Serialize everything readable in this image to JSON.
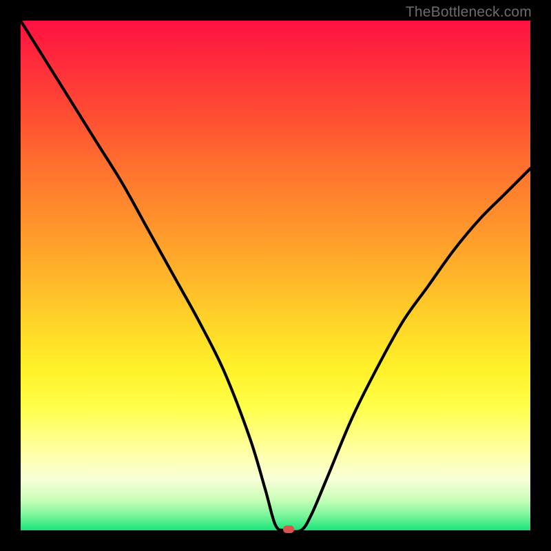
{
  "watermark": "TheBottleneck.com",
  "chart_data": {
    "type": "line",
    "title": "",
    "xlabel": "",
    "ylabel": "",
    "xlim": [
      0,
      100
    ],
    "ylim": [
      0,
      100
    ],
    "grid": false,
    "legend": false,
    "series": [
      {
        "name": "bottleneck-curve",
        "x": [
          0,
          5,
          10,
          15,
          20,
          25,
          30,
          35,
          40,
          45,
          48,
          50,
          52,
          55,
          57,
          60,
          65,
          70,
          75,
          80,
          85,
          90,
          95,
          100
        ],
        "values": [
          100,
          92,
          84,
          76,
          68,
          59,
          50,
          41,
          31,
          18,
          8,
          1,
          0,
          0,
          3,
          10,
          22,
          32,
          41,
          48,
          55,
          61,
          66,
          71
        ]
      }
    ],
    "marker": {
      "x": 52.5,
      "y": 0
    },
    "gradient_stops": [
      {
        "pos": 0,
        "color": "#ff1141"
      },
      {
        "pos": 50,
        "color": "#ffae2a"
      },
      {
        "pos": 75,
        "color": "#ffff4a"
      },
      {
        "pos": 100,
        "color": "#19e47a"
      }
    ]
  }
}
